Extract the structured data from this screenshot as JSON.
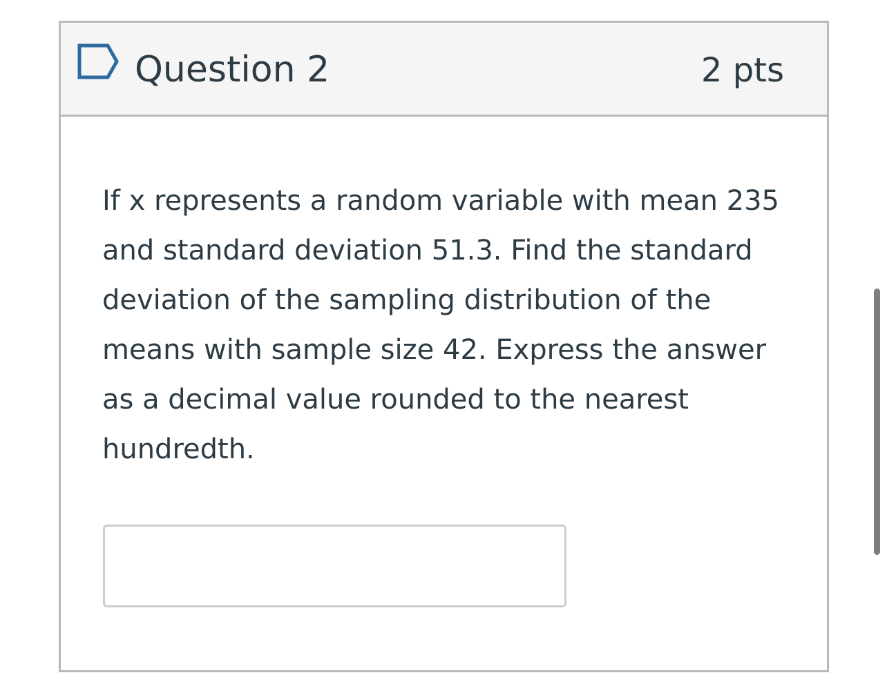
{
  "question": {
    "title": "Question 2",
    "points": "2 pts",
    "body": "If x represents a random variable with mean 235 and standard deviation 51.3. Find the standard deviation of the sampling distribution of the means with sample size 42. Express the answer as a decimal value rounded to the nearest hundredth.",
    "answer_value": "",
    "flag_icon": "flag-outline-icon"
  },
  "colors": {
    "header_bg": "#f5f5f5",
    "border": "#b7b9bb",
    "text": "#2d3b45",
    "flag_stroke": "#2d6a9f",
    "scrollbar": "#7e7e7e"
  }
}
